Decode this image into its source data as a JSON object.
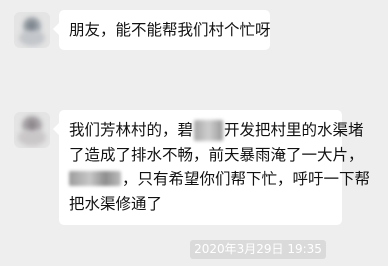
{
  "messages": [
    {
      "text": "朋友，能不能帮我们村个忙呀"
    },
    {
      "lines": [
        {
          "before": "我们芳林村的，碧",
          "blurred": "桂园",
          "after": "开发把村里的水渠堵"
        },
        {
          "text": "了造成了排水不畅，前天暴雨淹了一大片，"
        },
        {
          "after": "，只有希望你们帮下忙，呼吁一下帮"
        },
        {
          "text": "把水渠修通了"
        }
      ]
    }
  ],
  "timestamp": "2020年3月29日 19:35",
  "colors": {
    "background": "#eeeeee",
    "bubble": "#ffffff",
    "text": "#111111",
    "timestamp_bg": "#dadada",
    "timestamp_text": "#ffffff"
  }
}
